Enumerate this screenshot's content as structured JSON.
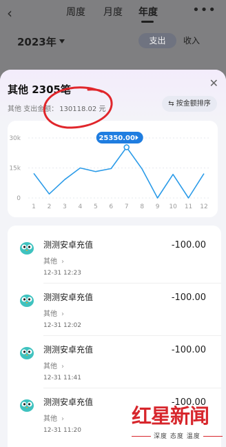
{
  "top_nav": {
    "tabs": [
      {
        "label": "周度"
      },
      {
        "label": "月度"
      },
      {
        "label": "年度"
      }
    ],
    "active_tab": "年度",
    "more_icon": "more-dots-icon",
    "back_icon": "back-arrow-icon"
  },
  "filter": {
    "year": "2023年",
    "toggle": [
      "支出",
      "收入"
    ],
    "active_toggle": "支出"
  },
  "sheet": {
    "title": "其他 2305笔",
    "total_label": "其他 支出金额：",
    "total_amount": "130118.02 元",
    "sort_button": "按金额排序",
    "close_icon": "close-icon"
  },
  "chart_data": {
    "type": "line",
    "x": [
      "1",
      "2",
      "3",
      "4",
      "5",
      "6",
      "7",
      "8",
      "9",
      "10",
      "11",
      "12"
    ],
    "series": [
      {
        "values": [
          12300,
          2000,
          9200,
          15000,
          13200,
          14700,
          25350,
          14500,
          0,
          11800,
          0,
          12200
        ]
      }
    ],
    "y_ticks": [
      "30k",
      "15k",
      "0"
    ],
    "ylim": [
      0,
      30000
    ],
    "highlight": {
      "index": 6,
      "label": "25350.00"
    },
    "line_color": "#2b9be8",
    "tooltip_color": "#1f7de0"
  },
  "transactions": [
    {
      "name": "测测安卓充值",
      "category": "其他",
      "time": "12-31 12:23",
      "amount": "-100.00"
    },
    {
      "name": "测测安卓充值",
      "category": "其他",
      "time": "12-31 12:02",
      "amount": "-100.00"
    },
    {
      "name": "测测安卓充值",
      "category": "其他",
      "time": "12-31 11:41",
      "amount": "-100.00"
    },
    {
      "name": "测测安卓充值",
      "category": "其他",
      "time": "12-31 11:20",
      "amount": "-100.00"
    }
  ],
  "watermark": {
    "logo": "红星新闻",
    "tagline": "深度 态度 温度"
  }
}
